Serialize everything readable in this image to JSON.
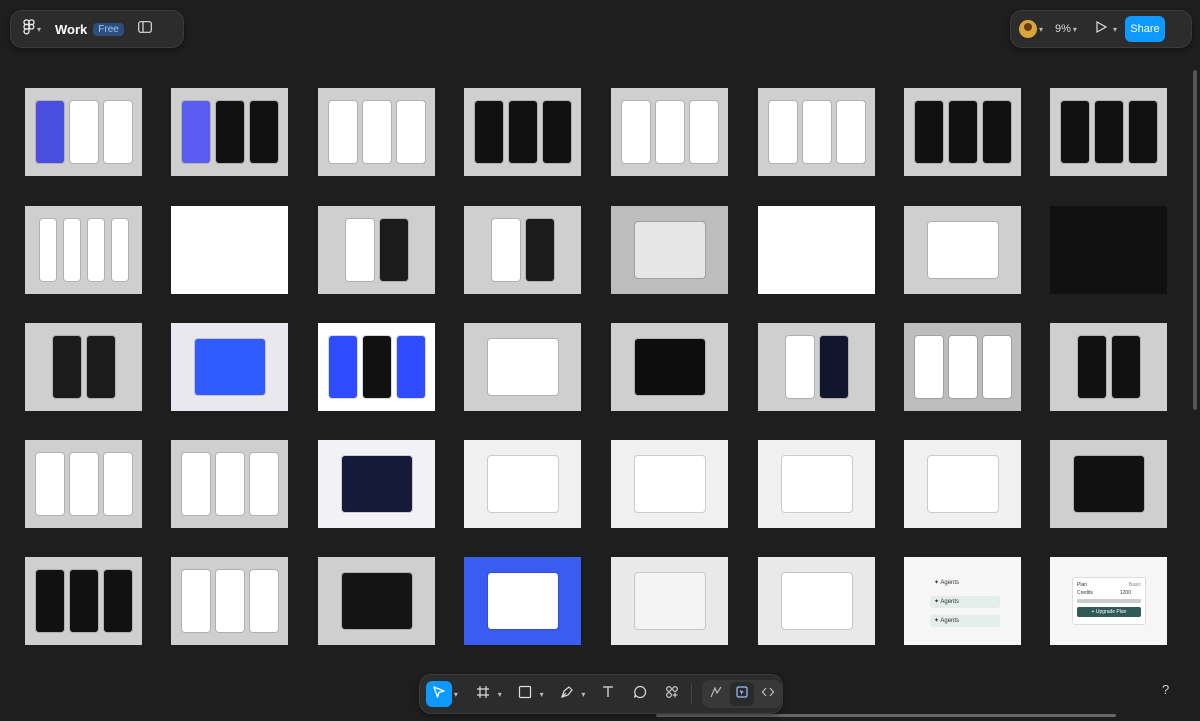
{
  "header": {
    "file_title": "Work",
    "plan_badge": "Free",
    "zoom_label": "9%",
    "share_label": "Share"
  },
  "footer": {
    "help_label": "?"
  },
  "thumbnails": [
    {
      "name": "frame-row1-col1",
      "bg": "#cfcfcf",
      "phones": [
        {
          "c": "#4b4fe0"
        },
        {
          "c": "#ffffff"
        },
        {
          "c": "#ffffff"
        }
      ]
    },
    {
      "name": "frame-row1-col2",
      "bg": "#cfcfcf",
      "phones": [
        {
          "c": "#5b5cf0"
        },
        {
          "c": "#111111"
        },
        {
          "c": "#111111"
        }
      ]
    },
    {
      "name": "frame-row1-col3",
      "bg": "#cfcfcf",
      "phones": [
        {
          "c": "#ffffff"
        },
        {
          "c": "#ffffff"
        },
        {
          "c": "#ffffff"
        }
      ]
    },
    {
      "name": "frame-row1-col4",
      "bg": "#cfcfcf",
      "phones": [
        {
          "c": "#111111"
        },
        {
          "c": "#111111"
        },
        {
          "c": "#111111"
        }
      ]
    },
    {
      "name": "frame-row1-col5",
      "bg": "#cfcfcf",
      "phones": [
        {
          "c": "#ffffff"
        },
        {
          "c": "#ffffff"
        },
        {
          "c": "#ffffff"
        }
      ]
    },
    {
      "name": "frame-row1-col6",
      "bg": "#cfcfcf",
      "phones": [
        {
          "c": "#ffffff"
        },
        {
          "c": "#ffffff"
        },
        {
          "c": "#ffffff"
        }
      ]
    },
    {
      "name": "frame-row1-col7",
      "bg": "#cfcfcf",
      "phones": [
        {
          "c": "#111111"
        },
        {
          "c": "#111111"
        },
        {
          "c": "#111111"
        }
      ]
    },
    {
      "name": "frame-row1-col8",
      "bg": "#cfcfcf",
      "phones": [
        {
          "c": "#111111"
        },
        {
          "c": "#111111"
        },
        {
          "c": "#111111"
        }
      ]
    },
    {
      "name": "frame-row2-col1",
      "bg": "#cfcfcf",
      "phones": [
        {
          "c": "#ffffff"
        },
        {
          "c": "#ffffff"
        },
        {
          "c": "#ffffff"
        },
        {
          "c": "#ffffff"
        }
      ]
    },
    {
      "name": "frame-row2-col2",
      "bg": "#ffffff",
      "phones": []
    },
    {
      "name": "frame-row2-col3",
      "bg": "#cfcfcf",
      "phones": [
        {
          "c": "#ffffff"
        },
        {
          "c": "#1b1b1b"
        }
      ]
    },
    {
      "name": "frame-row2-col4",
      "bg": "#cfcfcf",
      "phones": [
        {
          "c": "#ffffff"
        },
        {
          "c": "#1b1b1b"
        }
      ]
    },
    {
      "name": "frame-row2-col5",
      "bg": "#bdbdbd",
      "phones": [
        {
          "c": "#e6e6e6"
        }
      ]
    },
    {
      "name": "frame-row2-col6",
      "bg": "#ffffff",
      "phones": []
    },
    {
      "name": "frame-row2-col7",
      "bg": "#cfcfcf",
      "phones": [
        {
          "c": "#ffffff"
        }
      ]
    },
    {
      "name": "frame-row2-col8",
      "bg": "#111111",
      "phones": []
    },
    {
      "name": "frame-row3-col1",
      "bg": "#cfcfcf",
      "phones": [
        {
          "c": "#1b1b1b"
        },
        {
          "c": "#1b1b1b"
        }
      ]
    },
    {
      "name": "frame-row3-col2",
      "bg": "#e8e8ee",
      "phones": [
        {
          "c": "#2f5bff"
        }
      ]
    },
    {
      "name": "frame-row3-col3",
      "bg": "#ffffff",
      "phones": [
        {
          "c": "#2f4cff"
        },
        {
          "c": "#111111"
        },
        {
          "c": "#2f4cff"
        }
      ]
    },
    {
      "name": "frame-row3-col4",
      "bg": "#cfcfcf",
      "phones": [
        {
          "c": "#ffffff"
        }
      ]
    },
    {
      "name": "frame-row3-col5",
      "bg": "#cfcfcf",
      "phones": [
        {
          "c": "#0d0d0d"
        }
      ]
    },
    {
      "name": "frame-row3-col6",
      "bg": "#cfcfcf",
      "phones": [
        {
          "c": "#ffffff"
        },
        {
          "c": "#12152e"
        }
      ]
    },
    {
      "name": "frame-row3-col7",
      "bg": "#bdbdbd",
      "phones": [
        {
          "c": "#ffffff"
        },
        {
          "c": "#ffffff"
        },
        {
          "c": "#ffffff"
        }
      ]
    },
    {
      "name": "frame-row3-col8",
      "bg": "#cfcfcf",
      "phones": [
        {
          "c": "#111111"
        },
        {
          "c": "#111111"
        }
      ]
    },
    {
      "name": "frame-row4-col1",
      "bg": "#cfcfcf",
      "phones": [
        {
          "c": "#ffffff"
        },
        {
          "c": "#ffffff"
        },
        {
          "c": "#ffffff"
        }
      ]
    },
    {
      "name": "frame-row4-col2",
      "bg": "#cfcfcf",
      "phones": [
        {
          "c": "#ffffff"
        },
        {
          "c": "#ffffff"
        },
        {
          "c": "#ffffff"
        }
      ]
    },
    {
      "name": "frame-row4-col3",
      "bg": "#f1f1f6",
      "phones": [
        {
          "c": "#151a3a"
        }
      ]
    },
    {
      "name": "frame-row4-col4",
      "bg": "#f0f0f0",
      "phones": [
        {
          "c": "#ffffff"
        }
      ]
    },
    {
      "name": "frame-row4-col5",
      "bg": "#f0f0f0",
      "phones": [
        {
          "c": "#ffffff"
        }
      ]
    },
    {
      "name": "frame-row4-col6",
      "bg": "#f0f0f0",
      "phones": [
        {
          "c": "#ffffff"
        }
      ]
    },
    {
      "name": "frame-row4-col7",
      "bg": "#f0f0f0",
      "phones": [
        {
          "c": "#ffffff"
        }
      ]
    },
    {
      "name": "frame-row4-col8",
      "bg": "#cfcfcf",
      "phones": [
        {
          "c": "#111111"
        }
      ]
    },
    {
      "name": "frame-row5-col1",
      "bg": "#cfcfcf",
      "phones": [
        {
          "c": "#111111"
        },
        {
          "c": "#111111"
        },
        {
          "c": "#111111"
        }
      ]
    },
    {
      "name": "frame-row5-col2",
      "bg": "#cfcfcf",
      "phones": [
        {
          "c": "#ffffff"
        },
        {
          "c": "#ffffff"
        },
        {
          "c": "#ffffff"
        }
      ]
    },
    {
      "name": "frame-row5-col3",
      "bg": "#cfcfcf",
      "phones": [
        {
          "c": "#141414"
        }
      ]
    },
    {
      "name": "frame-row5-col4",
      "bg": "#3a5cf0",
      "phones": [
        {
          "c": "#ffffff"
        }
      ]
    },
    {
      "name": "frame-row5-col5",
      "bg": "#e9e9e9",
      "phones": [
        {
          "c": "#f4f4f4"
        }
      ]
    },
    {
      "name": "frame-row5-col6",
      "bg": "#e9e9e9",
      "phones": [
        {
          "c": "#ffffff"
        }
      ]
    },
    {
      "name": "frame-row5-col7",
      "bg": "#f6f6f6",
      "phones": [],
      "labels": [
        "Agents",
        "Agents",
        "Agents"
      ]
    },
    {
      "name": "frame-row5-col8",
      "bg": "#f6f6f6",
      "phones": [],
      "card": {
        "plan_label": "Plan",
        "plan_value": "Basic",
        "credits_label": "Credits",
        "credits_value": "1200",
        "button_label": "Upgrade Plan"
      }
    }
  ],
  "icons": {
    "figma_menu": "figma-logo-icon",
    "sidebar_toggle": "sidebar-toggle-icon",
    "play": "play-icon",
    "move": "move-tool-icon",
    "frame": "frame-tool-icon",
    "shape": "rectangle-tool-icon",
    "pen": "pen-tool-icon",
    "text": "text-tool-icon",
    "comment": "comment-tool-icon",
    "actions": "actions-icon",
    "draw": "draw-mode-icon",
    "design": "design-mode-icon",
    "dev": "dev-mode-icon"
  },
  "colors": {
    "accent": "#0d99ff",
    "canvas": "#1e1e1e"
  }
}
